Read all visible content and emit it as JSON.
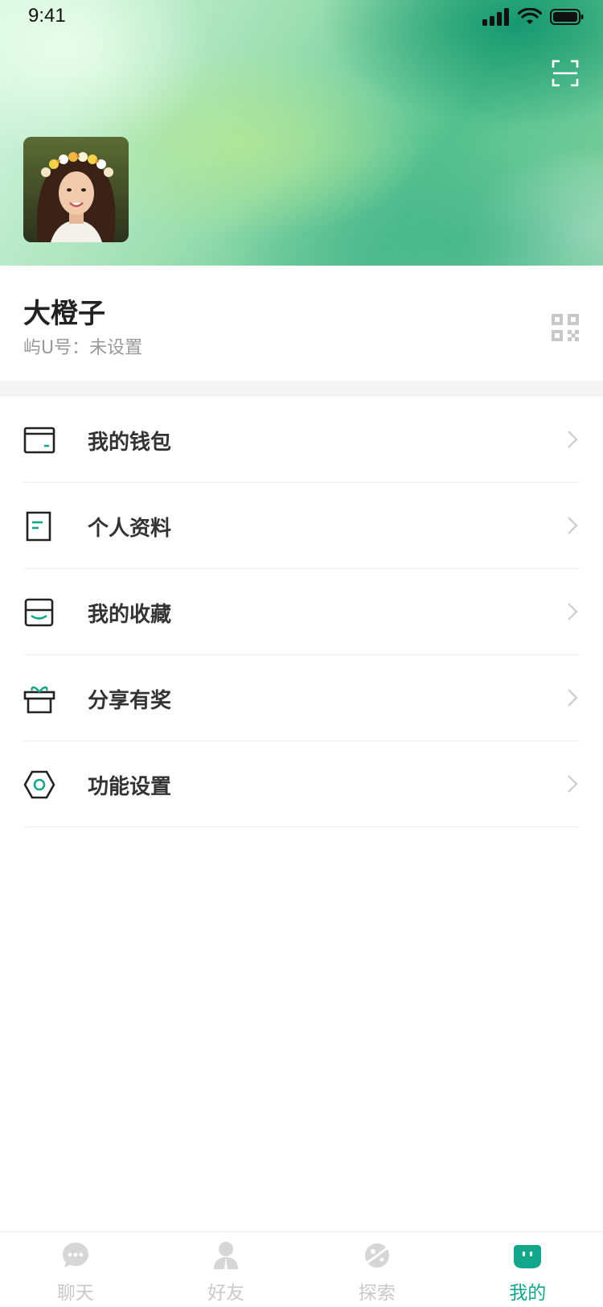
{
  "status_bar": {
    "time": "9:41"
  },
  "profile": {
    "name": "大橙子",
    "id_text": "屿U号：未设置"
  },
  "menu": {
    "items": [
      {
        "label": "我的钱包",
        "icon": "wallet-icon"
      },
      {
        "label": "个人资料",
        "icon": "document-icon"
      },
      {
        "label": "我的收藏",
        "icon": "inbox-icon"
      },
      {
        "label": "分享有奖",
        "icon": "gift-icon"
      },
      {
        "label": "功能设置",
        "icon": "settings-hexagon-icon"
      }
    ]
  },
  "tabbar": {
    "tabs": [
      {
        "label": "聊天",
        "icon": "chat-bubble-icon",
        "active": false
      },
      {
        "label": "好友",
        "icon": "person-icon",
        "active": false
      },
      {
        "label": "探索",
        "icon": "planet-icon",
        "active": false
      },
      {
        "label": "我的",
        "icon": "face-icon",
        "active": true
      }
    ]
  },
  "colors": {
    "accent": "#12a78a",
    "inactive": "#c9c9c9",
    "text": "#333333",
    "muted": "#999999"
  }
}
